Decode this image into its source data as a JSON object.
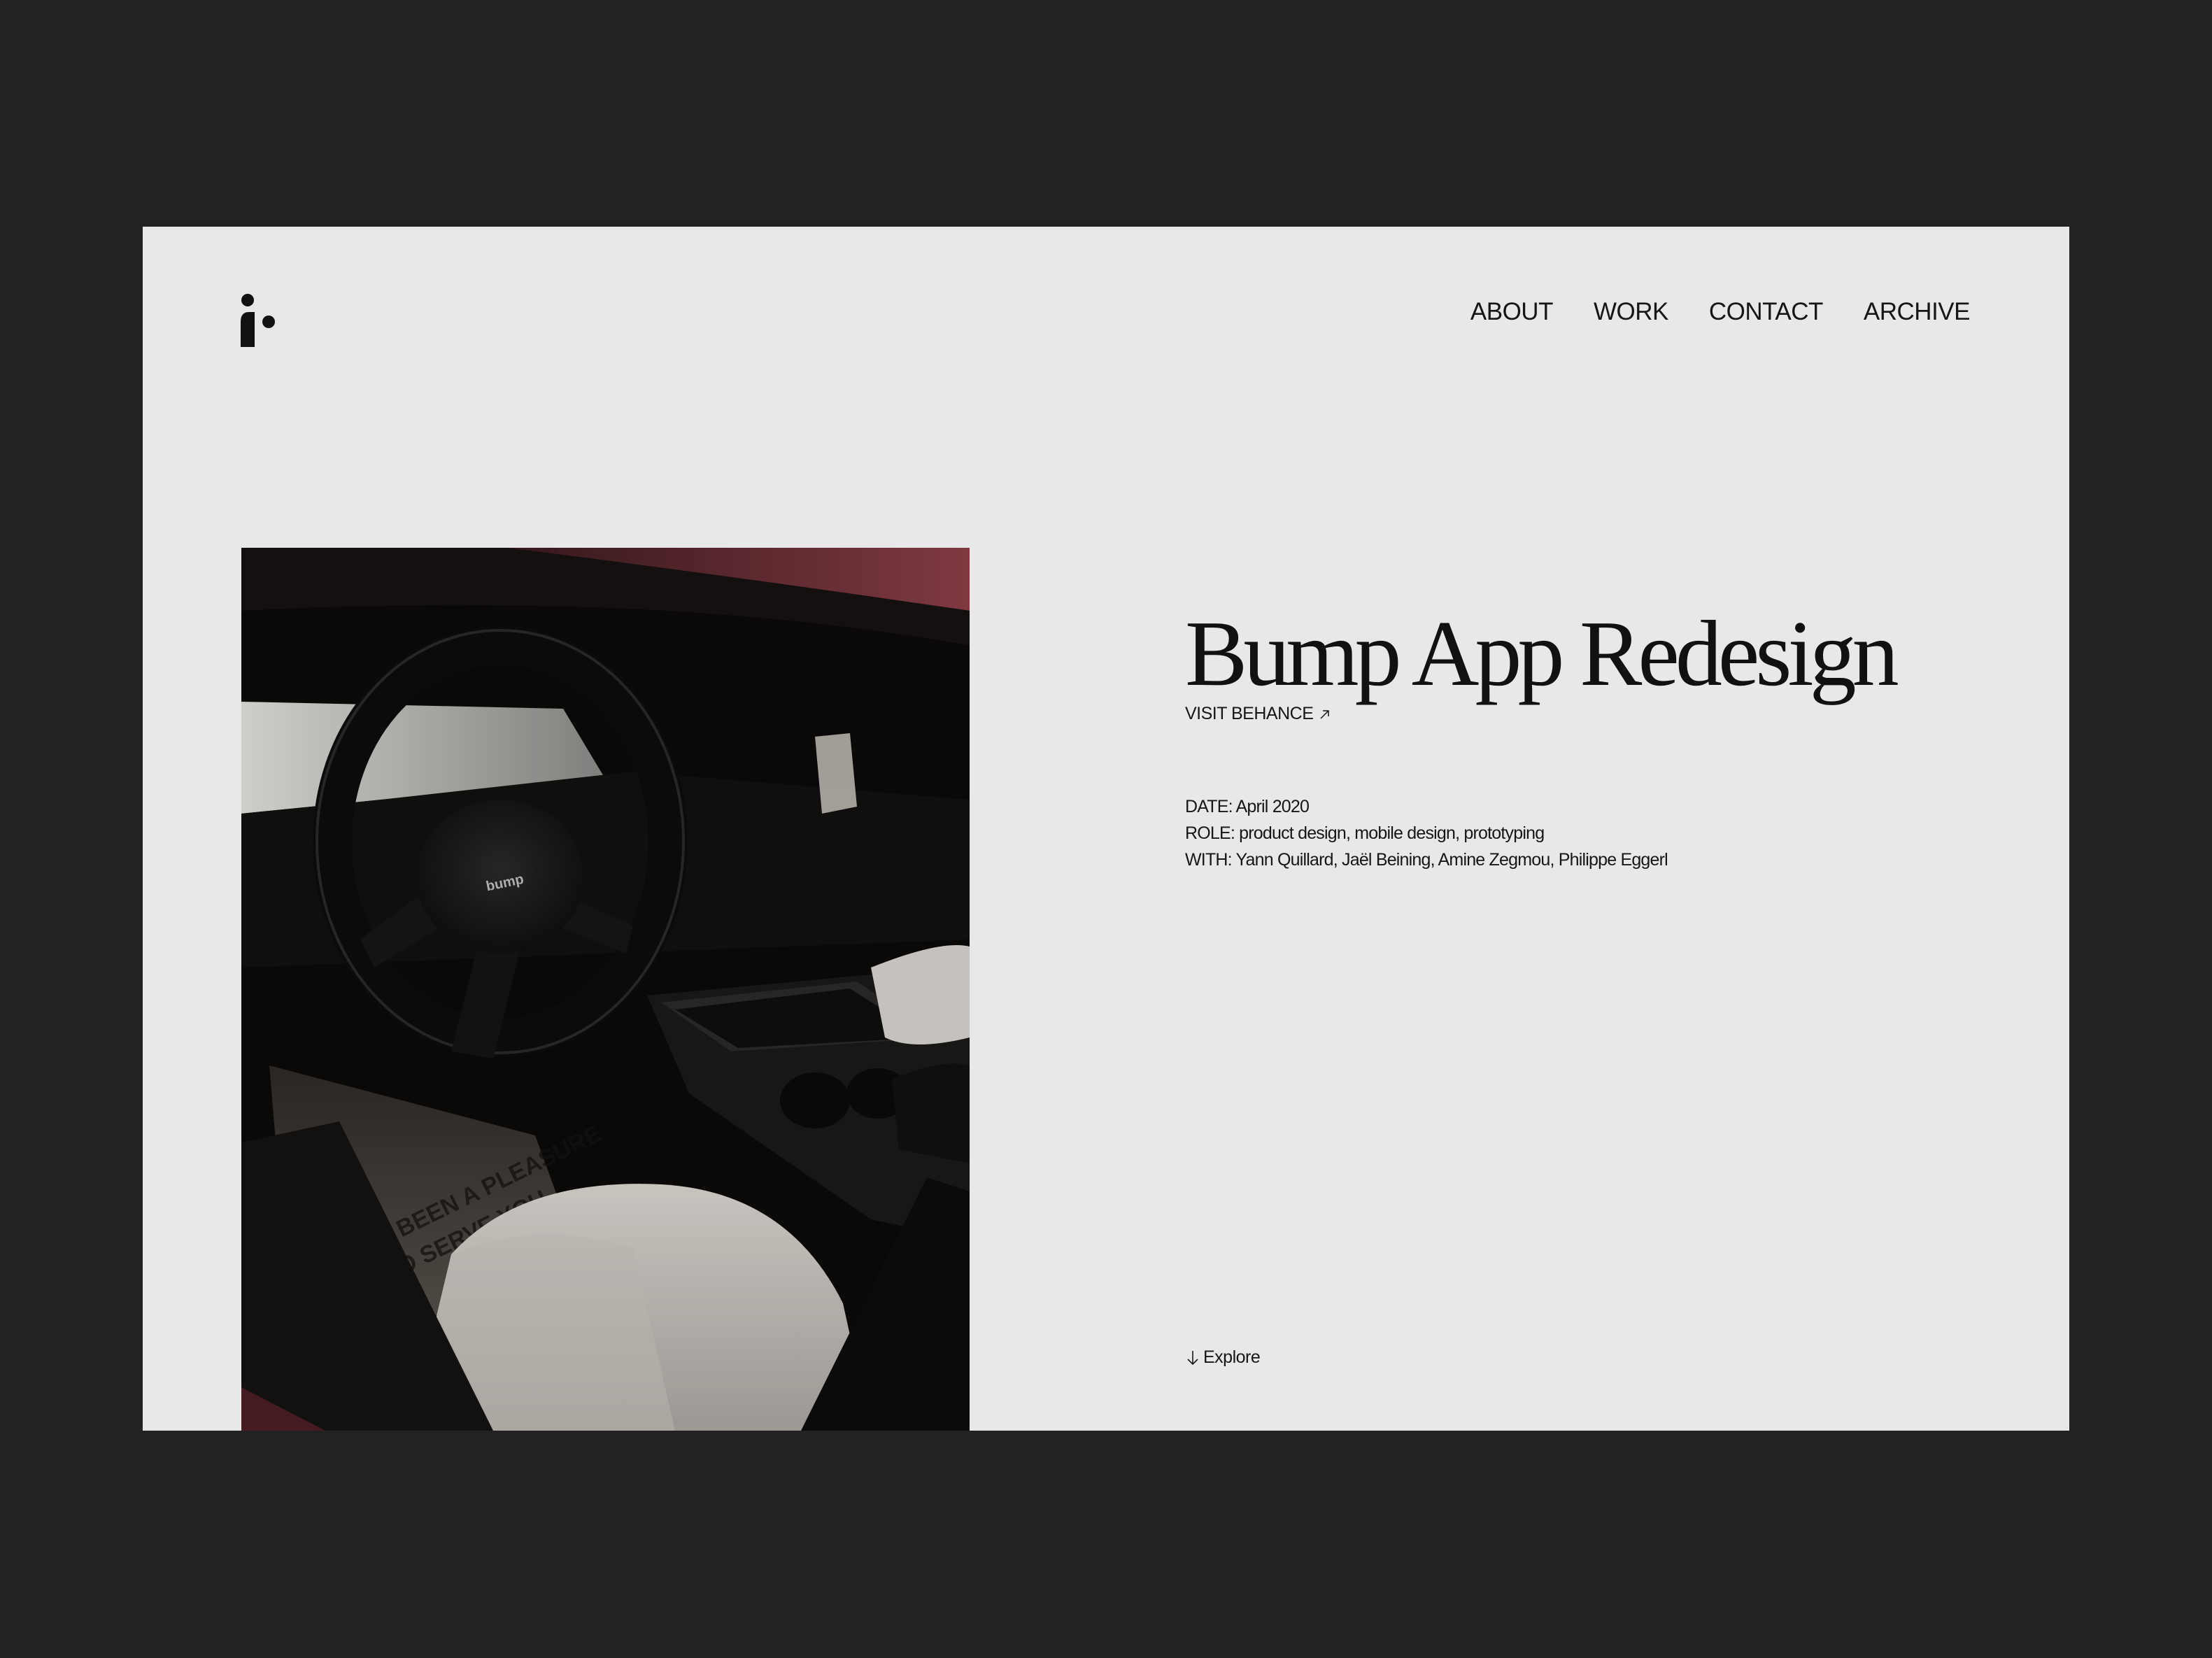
{
  "nav": {
    "items": [
      {
        "label": "ABOUT"
      },
      {
        "label": "WORK"
      },
      {
        "label": "CONTACT"
      },
      {
        "label": "ARCHIVE"
      }
    ]
  },
  "logo": {
    "icon": "brand-logo-icon"
  },
  "hero": {
    "image_description_icon": "car-interior-photo",
    "badge_text": "bump"
  },
  "project": {
    "title": "Bump App Redesign",
    "behance_label": "VISIT BEHANCE",
    "behance_icon": "arrow-up-right-icon",
    "date_line": "DATE: April 2020",
    "role_line": "ROLE: product design, mobile design, prototyping",
    "with_line": "WITH: Yann Quillard, Jaël Beining, Amine Zegmou, Philippe Eggerl"
  },
  "explore": {
    "label": "Explore",
    "icon": "arrow-down-icon"
  },
  "colors": {
    "backdrop": "#222222",
    "page": "#e8e8e8",
    "text": "#161616",
    "accent_red": "#7a2e35"
  }
}
